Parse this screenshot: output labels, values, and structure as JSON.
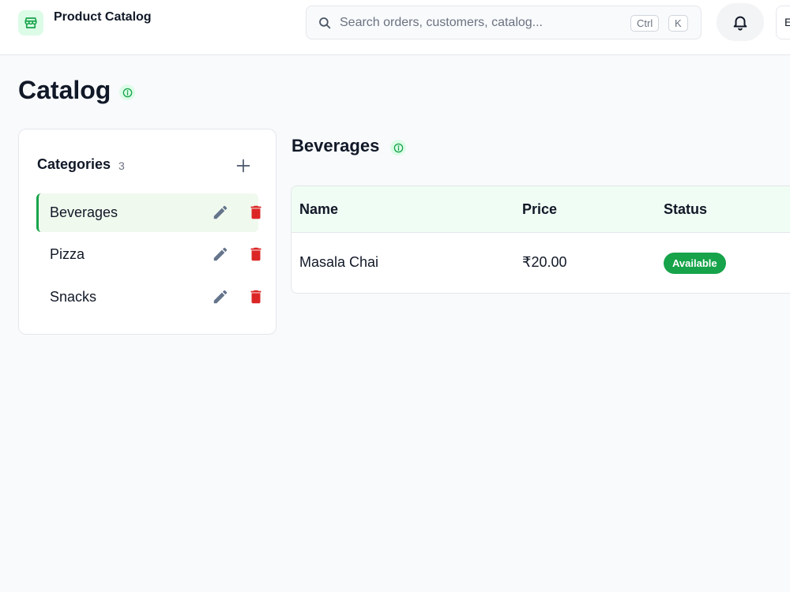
{
  "header": {
    "brand_title": "Product Catalog",
    "search": {
      "placeholder": "Search orders, customers, catalog...",
      "value": "",
      "shortcut_keys": [
        "Ctrl",
        "K"
      ]
    },
    "profile_initial": "E"
  },
  "page": {
    "title": "Catalog"
  },
  "categories": {
    "heading": "Categories",
    "count": "3",
    "items": [
      {
        "label": "Beverages",
        "active": true
      },
      {
        "label": "Pizza",
        "active": false
      },
      {
        "label": "Snacks",
        "active": false
      }
    ]
  },
  "products": {
    "section_title": "Beverages",
    "columns": [
      "Name",
      "Price",
      "Status"
    ],
    "rows": [
      {
        "name": "Masala Chai",
        "price": "₹20.00",
        "status": "Available"
      }
    ]
  },
  "colors": {
    "accent": "#16a34a",
    "accent_light": "#dcfce7",
    "delete": "#dc2626",
    "edit": "#64748b"
  }
}
